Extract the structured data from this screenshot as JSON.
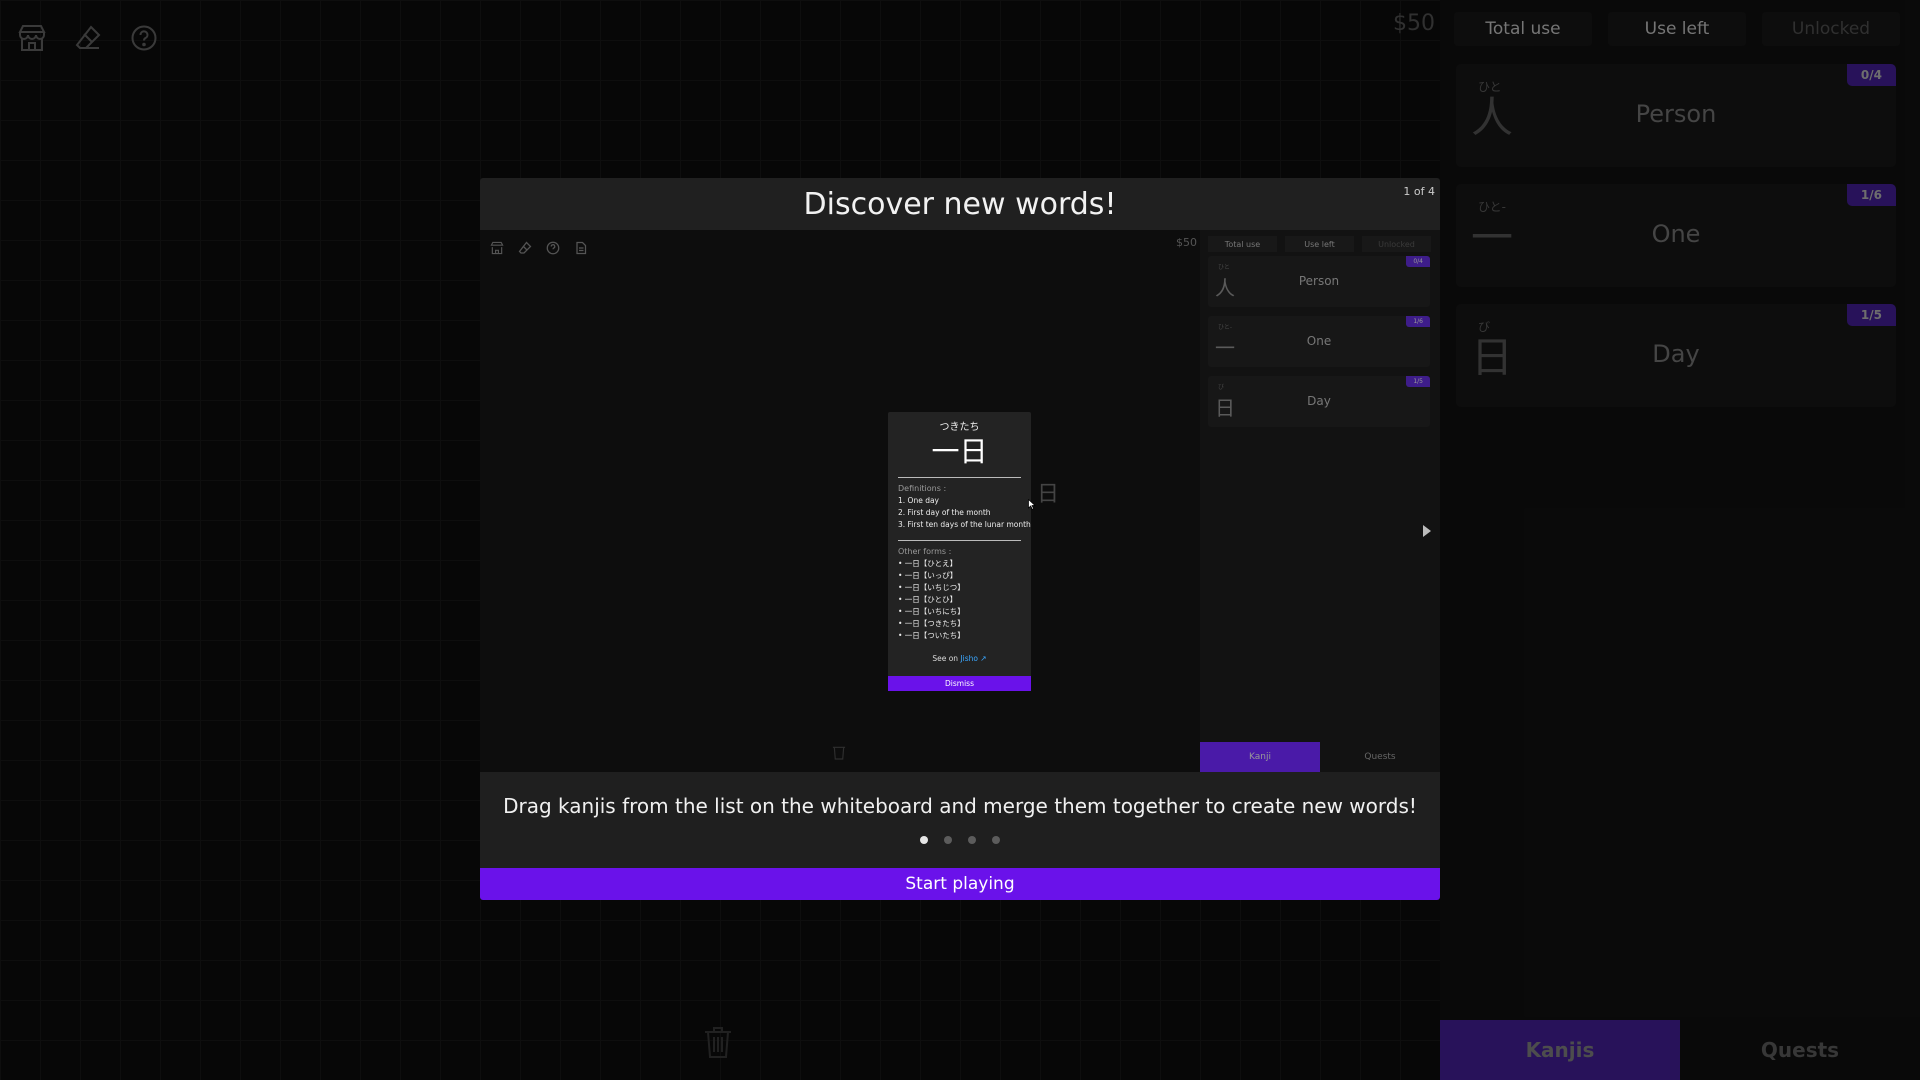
{
  "board": {
    "money": "$50"
  },
  "sidebar": {
    "filters": [
      "Total use",
      "Use left",
      "Unlocked"
    ],
    "kanjis": [
      {
        "reading": "ひと",
        "char": "人",
        "meaning": "Person",
        "badge": "0/4"
      },
      {
        "reading": "ひと-",
        "char": "一",
        "meaning": "One",
        "badge": "1/6"
      },
      {
        "reading": "び",
        "char": "日",
        "meaning": "Day",
        "badge": "1/5"
      }
    ],
    "tabs": [
      "Kanjis",
      "Quests"
    ]
  },
  "modal": {
    "title": "Discover new words!",
    "page": "1 of 4",
    "description": "Drag kanjis from the list on the whiteboard and merge them together to create new words!",
    "start_label": "Start playing",
    "dots": 4,
    "active_dot": 0
  },
  "preview": {
    "money": "$50",
    "filters": [
      "Total use",
      "Use left",
      "Unlocked"
    ],
    "kanjis": [
      {
        "reading": "ひと",
        "char": "人",
        "meaning": "Person",
        "badge": "0/4"
      },
      {
        "reading": "ひと-",
        "char": "一",
        "meaning": "One",
        "badge": "1/6"
      },
      {
        "reading": "び",
        "char": "日",
        "meaning": "Day",
        "badge": "1/5"
      }
    ],
    "tabs": [
      "Kanji",
      "Quests"
    ],
    "ghost_char": "日",
    "popup": {
      "reading": "つきたち",
      "word": "一日",
      "definitions_label": "Definitions :",
      "definitions": [
        "1. One day",
        "2. First day of the month",
        "3. First ten days of the lunar month"
      ],
      "other_forms_label": "Other forms :",
      "other_forms": [
        "• 一日【ひとえ】",
        "• 一日【いっぴ】",
        "• 一日【いちじつ】",
        "• 一日【ひとひ】",
        "• 一日【いちにち】",
        "• 一日【つきたち】",
        "• 一日【ついたち】"
      ],
      "see_on": "See on",
      "jisho_label": "Jisho ↗",
      "dismiss_label": "Dismiss"
    }
  }
}
